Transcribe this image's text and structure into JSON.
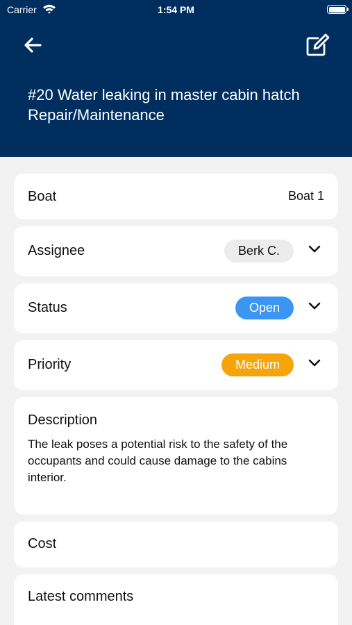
{
  "status_bar": {
    "carrier": "Carrier",
    "time": "1:54 PM"
  },
  "header": {
    "title_line": "#20 Water leaking in master cabin hatch",
    "category": "Repair/Maintenance",
    "back_icon": "arrow-left-icon",
    "edit_icon": "edit-icon"
  },
  "boat": {
    "label": "Boat",
    "value": "Boat 1"
  },
  "assignee": {
    "label": "Assignee",
    "value": "Berk C."
  },
  "status": {
    "label": "Status",
    "value": "Open",
    "color": "#3a95f3"
  },
  "priority": {
    "label": "Priority",
    "value": "Medium",
    "color": "#f7a30a"
  },
  "description": {
    "label": "Description",
    "text": "The leak poses a potential risk to the safety of the occupants and could cause damage to the cabins interior."
  },
  "cost": {
    "label": "Cost"
  },
  "comments": {
    "label": "Latest comments"
  },
  "colors": {
    "header_bg": "#002f5f",
    "page_bg": "#f2f2f2"
  }
}
